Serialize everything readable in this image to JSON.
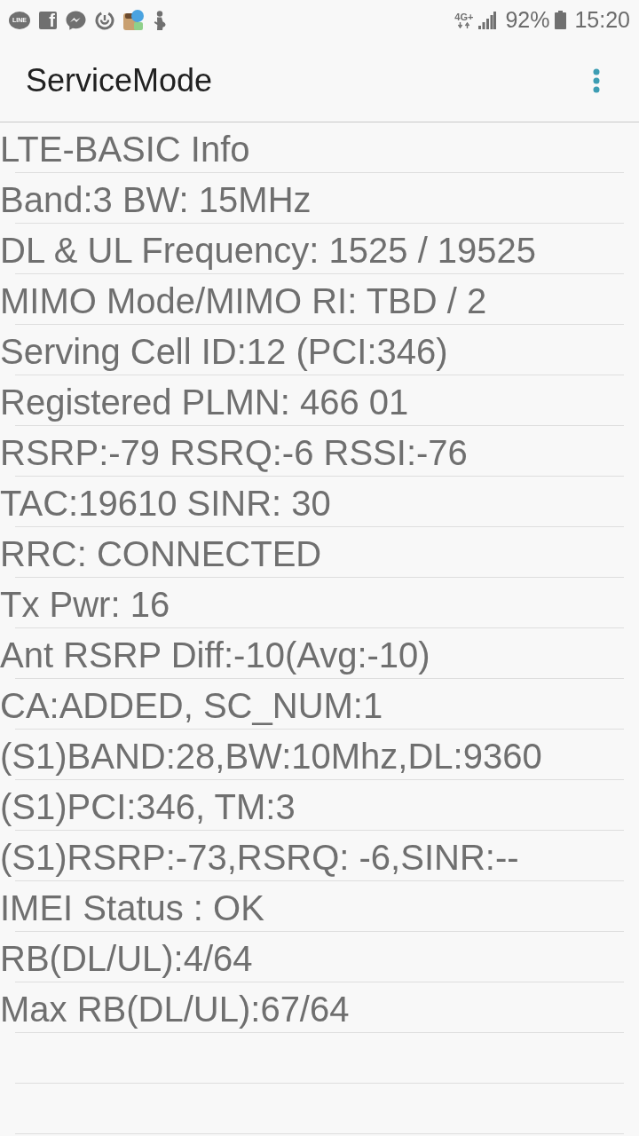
{
  "status_bar": {
    "notification_icons": [
      {
        "kind": "bubble-text",
        "label": "LINE"
      },
      {
        "kind": "tile-letter",
        "label": "f"
      },
      {
        "kind": "bubble-zigzag"
      },
      {
        "kind": "ring"
      },
      {
        "kind": "app-tile"
      },
      {
        "kind": "figure"
      }
    ],
    "network": "4G+",
    "battery": "92%",
    "time": "15:20"
  },
  "app_bar": {
    "title": "ServiceMode"
  },
  "rows": [
    "LTE-BASIC Info",
    "Band:3 BW: 15MHz",
    "DL & UL Frequency: 1525 / 19525",
    "MIMO Mode/MIMO RI: TBD / 2",
    "Serving Cell ID:12 (PCI:346)",
    "Registered PLMN: 466 01",
    "RSRP:-79 RSRQ:-6 RSSI:-76",
    "TAC:19610 SINR: 30",
    "RRC: CONNECTED",
    "Tx Pwr: 16",
    "Ant RSRP Diff:-10(Avg:-10)",
    "CA:ADDED, SC_NUM:1",
    "(S1)BAND:28,BW:10Mhz,DL:9360",
    "(S1)PCI:346, TM:3",
    "(S1)RSRP:-73,RSRQ: -6,SINR:--",
    "IMEI Status : OK",
    "RB(DL/UL):4/64",
    "Max RB(DL/UL):67/64"
  ]
}
